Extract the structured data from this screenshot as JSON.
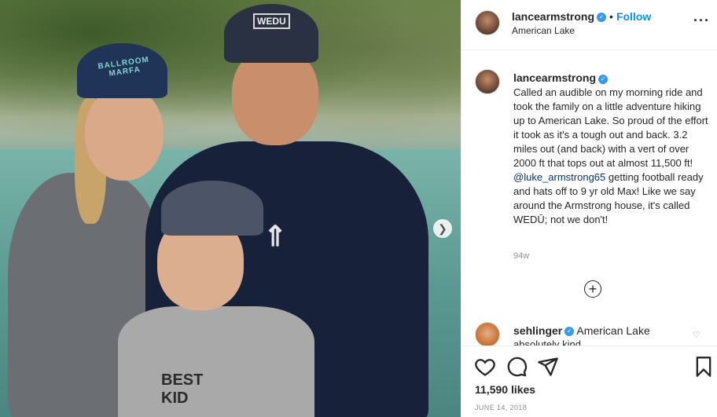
{
  "post": {
    "photo": {
      "cap_woman_text": "BALLROOM MARFA",
      "cap_man_logo": "WEDU",
      "boy_shirt_text": "BEST KID",
      "next_icon": "chevron-right-icon"
    },
    "header": {
      "username": "lancearmstrong",
      "dot": "•",
      "follow_label": "Follow",
      "location": "American Lake",
      "more_icon": "more-horizontal-icon"
    },
    "caption": {
      "username": "lancearmstrong",
      "text_part1": "Called an audible on my morning ride and took the family on a little adventure hiking up to American Lake. So proud of the effort it took as it's a tough out and back. 3.2 miles out (and back) with a vert of over 2000 ft that tops out at almost 11,500 ft!",
      "mention": "@luke_armstrong65",
      "text_part2": " getting football ready and hats off to 9 yr old Max! Like we say around the Armstrong house, it's called WEDŪ; not we don't!",
      "time": "94w"
    },
    "load_more_icon": "plus-circle-icon",
    "comment": {
      "username": "sehlinger",
      "text": "American Lake",
      "partial": "absolutely kind"
    },
    "actions": {
      "like_icon": "heart-icon",
      "comment_icon": "comment-icon",
      "share_icon": "share-icon",
      "save_icon": "bookmark-icon"
    },
    "likes": "11,590 likes",
    "date": "JUNE 14, 2018"
  }
}
